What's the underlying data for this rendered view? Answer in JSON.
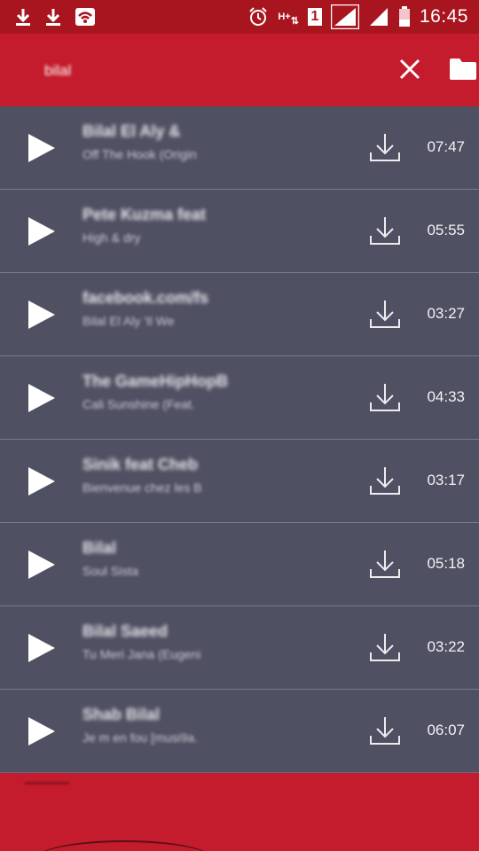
{
  "status_bar": {
    "time": "16:45",
    "network_label": "H+",
    "sim_slot": "1",
    "icons": [
      "download-icon",
      "download-icon",
      "wifi-icon",
      "alarm-icon",
      "signal-icon",
      "signal-icon",
      "battery-icon"
    ]
  },
  "search": {
    "value": "bilal",
    "placeholder": ""
  },
  "toolbar": {
    "close_icon": "close-icon",
    "folder_icon": "folder-icon"
  },
  "tracks": [
    {
      "title": "Bilal El Aly &",
      "subtitle": "Off The Hook (Origin",
      "duration": "07:47"
    },
    {
      "title": "Pete Kuzma feat",
      "subtitle": "High & dry",
      "duration": "05:55"
    },
    {
      "title": "facebook.com/fs",
      "subtitle": "Bilal El Aly 'Il We",
      "duration": "03:27"
    },
    {
      "title": "The GameHipHopB",
      "subtitle": "Cali Sunshine (Feat.",
      "duration": "04:33"
    },
    {
      "title": "Sinik feat Cheb",
      "subtitle": "Bienvenue chez les B",
      "duration": "03:17"
    },
    {
      "title": "Bilal",
      "subtitle": "Soul Sista",
      "duration": "05:18"
    },
    {
      "title": "Bilal Saeed",
      "subtitle": "Tu Meri Jana (Eugeni",
      "duration": "03:22"
    },
    {
      "title": "Shab Bilal",
      "subtitle": "Je m en fou [musi9a.",
      "duration": "06:07"
    }
  ],
  "colors": {
    "accent": "#c41c2c",
    "status_bar": "#a8151f",
    "list_background": "#505063",
    "divider": "#7a7a8e"
  }
}
